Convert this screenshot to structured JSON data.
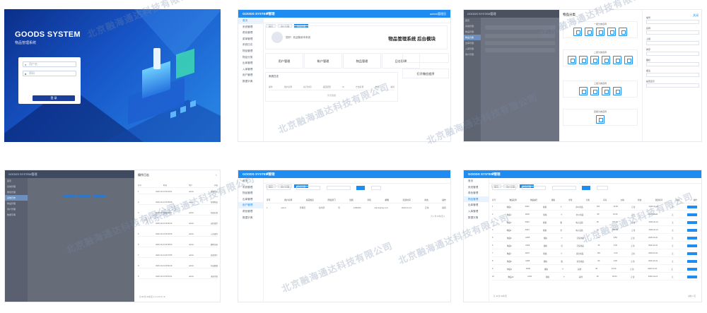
{
  "watermark": "北京融海通达科技有限公司",
  "login": {
    "brand": "GOODS SYSTEM",
    "subtitle": "物品管理系统",
    "username_placeholder": "用户名",
    "password_placeholder": "密码",
    "login_button": "登 录"
  },
  "admin": {
    "app_title": "GOODS SYSTEM管理",
    "menu_icon": "≡",
    "top_right": "admin管理员",
    "sidebar_items": [
      "首页",
      "系统管理",
      "角色管理",
      "菜单管理",
      "系统日志",
      "物品管理",
      "物品分类",
      "出库管理",
      "入库管理",
      "用户管理",
      "数据字典"
    ],
    "tabs": [
      "首页",
      "用户管理",
      "角色管理"
    ]
  },
  "dashboard": {
    "welcome": "您好！欢迎使用本系统",
    "title": "物品管理系统 后台模块",
    "quick_links": [
      "用户管理",
      "帐户管理",
      "物品管理",
      "日志管理"
    ],
    "panel_title": "系统日志",
    "columns": [
      "操作",
      "用户名称",
      "执行时间",
      "返回结果",
      "IP",
      "方法名称",
      "参数",
      "耗时"
    ],
    "no_data": "暂无数据",
    "side_button": "打开微信程序"
  },
  "category": {
    "drawer_title": "物品分类",
    "groups": [
      {
        "title": "一级分类名称",
        "count": 5
      },
      {
        "title": "二级分类名称",
        "count": 6
      },
      {
        "title": "三级分类名称",
        "count": 4
      },
      {
        "title": "四级分类名称",
        "count": 1
      }
    ],
    "form_labels": [
      "编号",
      "名称",
      "上级",
      "排序",
      "图标",
      "备注",
      "是否显示"
    ],
    "close": "关闭"
  },
  "logs": {
    "title": "操作日志",
    "columns": [
      "序号",
      "时间",
      "用户",
      "内容"
    ],
    "rows": [
      [
        "1",
        "2020-10-21 09:34:21",
        "admin",
        "登录系统"
      ],
      [
        "2",
        "2020-10-21 09:35:08",
        "admin",
        "新增物品"
      ],
      [
        "3",
        "2020-10-21 09:36:47",
        "admin",
        "修改分类"
      ],
      [
        "4",
        "2020-10-21 09:40:12",
        "admin",
        "出库操作"
      ],
      [
        "5",
        "2020-10-21 09:42:30",
        "admin",
        "入库操作"
      ],
      [
        "6",
        "2020-10-21 09:45:03",
        "admin",
        "删除记录"
      ],
      [
        "7",
        "2020-10-21 09:47:55",
        "admin",
        "修改用户"
      ],
      [
        "8",
        "2020-10-21 09:50:18",
        "admin",
        "导出数据"
      ],
      [
        "9",
        "2020-10-21 09:52:41",
        "admin",
        "退出系统"
      ]
    ],
    "pager": "共 80 条  10条/页  1 2 3 4 5 6 7 8"
  },
  "users": {
    "columns": [
      "序号",
      "用户名称",
      "真实姓名",
      "所属部门",
      "性别",
      "手机",
      "邮箱",
      "创建时间",
      "状态",
      "操作"
    ],
    "row": [
      "1",
      "admin",
      "管理员",
      "技术部",
      "男",
      "1380000",
      "admin@qq.com",
      "2020-10-21",
      "正常",
      "编辑"
    ],
    "pager": "共 1 条  10条/页  1"
  },
  "goods": {
    "columns": [
      "序号",
      "物品名称",
      "物品编号",
      "规格",
      "单位",
      "分类",
      "库存",
      "价格",
      "状态",
      "创建时间",
      "备注",
      "操作"
    ],
    "rows": [
      [
        "1",
        "物品1",
        "A001",
        "规格",
        "个",
        "办公用品",
        "100",
        "12.00",
        "正常",
        "2020-10-21",
        "无"
      ],
      [
        "2",
        "物品2",
        "A002",
        "规格",
        "个",
        "办公用品",
        "80",
        "15.00",
        "正常",
        "2020-10-21",
        "无"
      ],
      [
        "3",
        "物品3",
        "A003",
        "规格",
        "箱",
        "电子设备",
        "25",
        "320.00",
        "正常",
        "2020-10-21",
        "无"
      ],
      [
        "4",
        "物品4",
        "A004",
        "规格",
        "台",
        "电子设备",
        "12",
        "980.00",
        "正常",
        "2020-10-21",
        "无"
      ],
      [
        "5",
        "物品5",
        "A005",
        "规格",
        "个",
        "劳保用品",
        "60",
        "8.50",
        "正常",
        "2020-10-21",
        "无"
      ],
      [
        "6",
        "物品6",
        "A006",
        "规格",
        "包",
        "劳保用品",
        "45",
        "6.00",
        "正常",
        "2020-10-21",
        "无"
      ],
      [
        "7",
        "物品7",
        "A007",
        "规格",
        "个",
        "清洁用品",
        "150",
        "3.20",
        "正常",
        "2020-10-21",
        "无"
      ],
      [
        "8",
        "物品8",
        "A008",
        "规格",
        "瓶",
        "清洁用品",
        "90",
        "9.90",
        "正常",
        "2020-10-21",
        "无"
      ],
      [
        "9",
        "物品9",
        "A009",
        "规格",
        "个",
        "其他",
        "30",
        "22.00",
        "正常",
        "2020-10-21",
        "无"
      ],
      [
        "10",
        "物品10",
        "A010",
        "规格",
        "个",
        "其他",
        "18",
        "45.00",
        "正常",
        "2020-10-21",
        "无"
      ]
    ],
    "pager": "共 10 条  10条/页",
    "pager_right": "前往 1 页"
  },
  "colors": {
    "primary": "#1e8cf0",
    "login_bg_dark": "#0c2f8a",
    "login_bg_light": "#2a8be8"
  }
}
